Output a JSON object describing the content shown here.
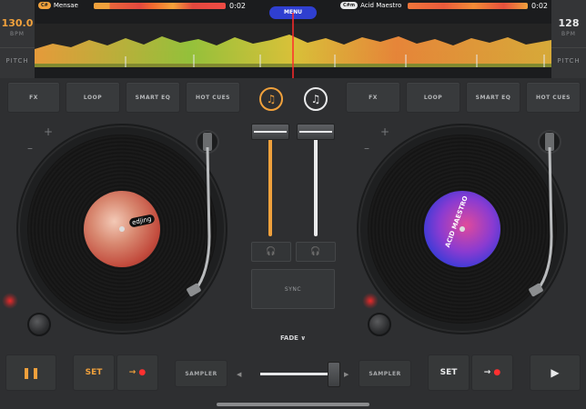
{
  "colors": {
    "deck_left_accent": "#f0a13c",
    "deck_right_accent": "#e9eaeb",
    "menu_button": "#2f3fd0",
    "led_red": "#ff2828"
  },
  "deck_left": {
    "bpm": "130.0",
    "bpm_unit": "BPM",
    "pitch_label": "PITCH",
    "badge": "C#",
    "track": "Mensae",
    "time": "0:02",
    "pads": [
      "FX",
      "LOOP",
      "SMART EQ",
      "HOT CUES"
    ],
    "headphone_icon": "headphones-icon",
    "play_icon": "pause-icon",
    "set_label": "SET",
    "sampler_label": "SAMPLER",
    "label_text": "edjing",
    "plus": "+",
    "minus": "–"
  },
  "deck_right": {
    "bpm": "128",
    "bpm_unit": "BPM",
    "pitch_label": "PITCH",
    "badge": "C#m",
    "track": "Acid Maestro",
    "time": "0:02",
    "pads": [
      "FX",
      "LOOP",
      "SMART EQ",
      "HOT CUES"
    ],
    "play_icon": "play-icon",
    "set_label": "SET",
    "sampler_label": "SAMPLER",
    "label_text": "ACID MAESTRO",
    "plus": "+",
    "minus": "–"
  },
  "top": {
    "menu_label": "MENU"
  },
  "mixer": {
    "sync_label": "SYNC",
    "fade_label": "FADE ∨"
  }
}
